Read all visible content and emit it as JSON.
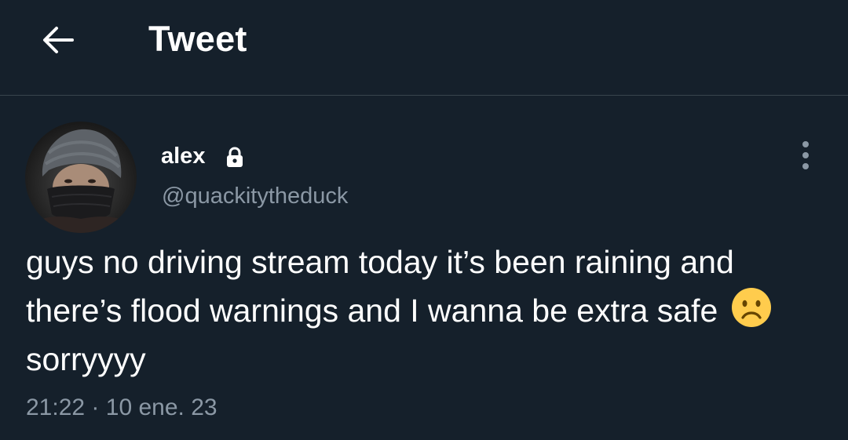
{
  "header": {
    "back_icon": "arrow-left-icon",
    "title": "Tweet"
  },
  "tweet": {
    "author": {
      "display_name": "alex",
      "protected_icon": "lock-icon",
      "handle": "@quackitytheduck",
      "avatar": "avatar-photo"
    },
    "more_icon": "more-vertical-icon",
    "text_before_emoji": "guys no driving stream today it’s been raining and there’s flood warnings and I wanna be extra safe",
    "emoji": "frowning-face-emoji",
    "text_after_emoji": "sorryyyy",
    "time": "21:22",
    "separator": "·",
    "date": "10 ene. 23"
  },
  "colors": {
    "background": "#15202b",
    "text_primary": "#ffffff",
    "text_secondary": "#8b98a5",
    "divider": "#38444d"
  }
}
